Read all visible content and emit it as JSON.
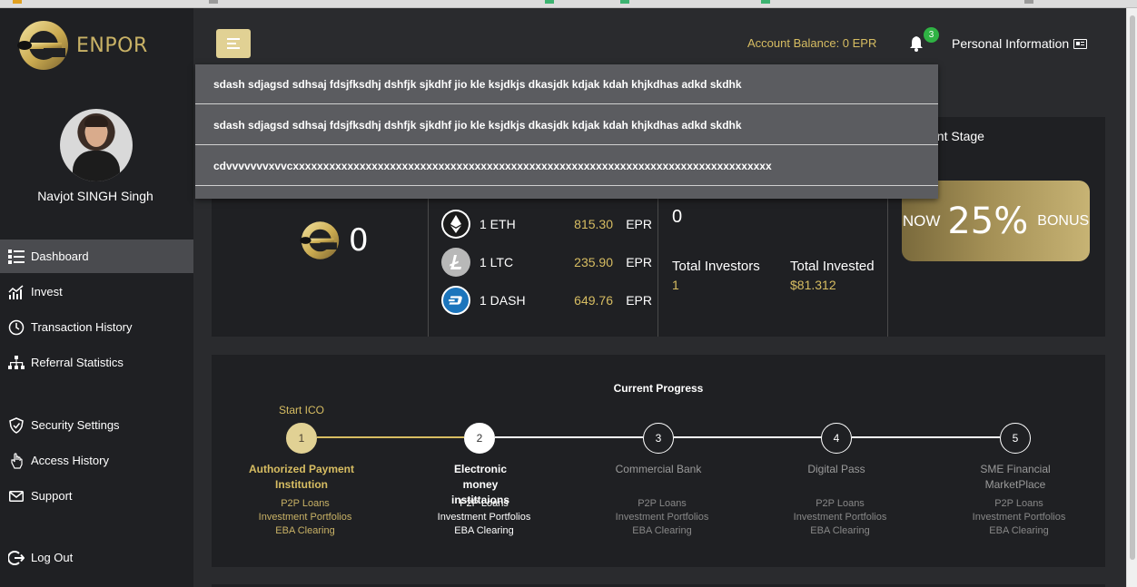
{
  "brand": {
    "name": "ENPOR"
  },
  "sidebar": {
    "user_name": "Navjot SINGH Singh",
    "items": [
      {
        "label": "Dashboard",
        "icon": "list-icon",
        "active": true
      },
      {
        "label": "Invest",
        "icon": "chart-icon"
      },
      {
        "label": "Transaction History",
        "icon": "clock-icon"
      },
      {
        "label": "Referral Statistics",
        "icon": "sitemap-icon"
      },
      {
        "label": "Security Settings",
        "icon": "shield-icon"
      },
      {
        "label": "Access History",
        "icon": "hand-icon"
      },
      {
        "label": "Support",
        "icon": "envelope-icon"
      },
      {
        "label": "Log Out",
        "icon": "logout-icon"
      }
    ]
  },
  "header": {
    "account_balance": "Account Balance: 0 EPR",
    "notification_count": "3",
    "personal_info": "Personal Information"
  },
  "notifications": [
    "sdash sdjagsd sdhsaj fdsjfksdhj dshfjk sjkdhf jio kle ksjdkjs dkasjdk kdjak kdah khjkdhas adkd skdhk",
    "sdash sdjagsd sdhsaj fdsjfksdhj dshfjk sjkdhf jio kle ksjdkjs dkasjdk kdjak kdah khjkdhas adkd skdhk",
    "cdvvvvvvvxvvcxxxxxxxxxxxxxxxxxxxxxxxxxxxxxxxxxxxxxxxxxxxxxxxxxxxxxxxxxxxxxxxxxxxxxxxxxxxxxxx"
  ],
  "wallet": {
    "amount": "0"
  },
  "rates": [
    {
      "coin": "1 ETH",
      "value": "815.30",
      "unit": "EPR",
      "icon": "eth-icon",
      "color": "#1a1a1a"
    },
    {
      "coin": "1 LTC",
      "value": "235.90",
      "unit": "EPR",
      "icon": "ltc-icon",
      "color": "#b8b8b8"
    },
    {
      "coin": "1 DASH",
      "value": "649.76",
      "unit": "EPR",
      "icon": "dash-icon",
      "color": "#1c75bc"
    }
  ],
  "stats": {
    "top_value": "0",
    "total_investors_label": "Total Investors",
    "total_investors_value": "1",
    "total_invested_label": "Total Invested",
    "total_invested_value": "$81.312"
  },
  "stage": {
    "title": "ent Stage",
    "now": "NOW",
    "percent": "25%",
    "bonus": "BONUS"
  },
  "progress": {
    "title": "Current Progress",
    "start_label": "Start ICO",
    "steps": [
      {
        "num": "1",
        "name": "Authorized Payment Institution",
        "status": "done"
      },
      {
        "num": "2",
        "name": "Electronic money instittaions",
        "status": "current"
      },
      {
        "num": "3",
        "name": "Commercial Bank",
        "status": "pending"
      },
      {
        "num": "4",
        "name": "Digital Pass",
        "status": "pending"
      },
      {
        "num": "5",
        "name": "SME Financial MarketPlace",
        "status": "pending"
      }
    ],
    "sub_items": [
      "P2P Loans",
      "Investment Portfolios",
      "EBA Clearing"
    ]
  },
  "colors": {
    "gold": "#d7bd62",
    "panel": "#1f2023",
    "background": "#2a2b2e",
    "accent_button": "#e1d194",
    "badge": "#2fb344"
  }
}
